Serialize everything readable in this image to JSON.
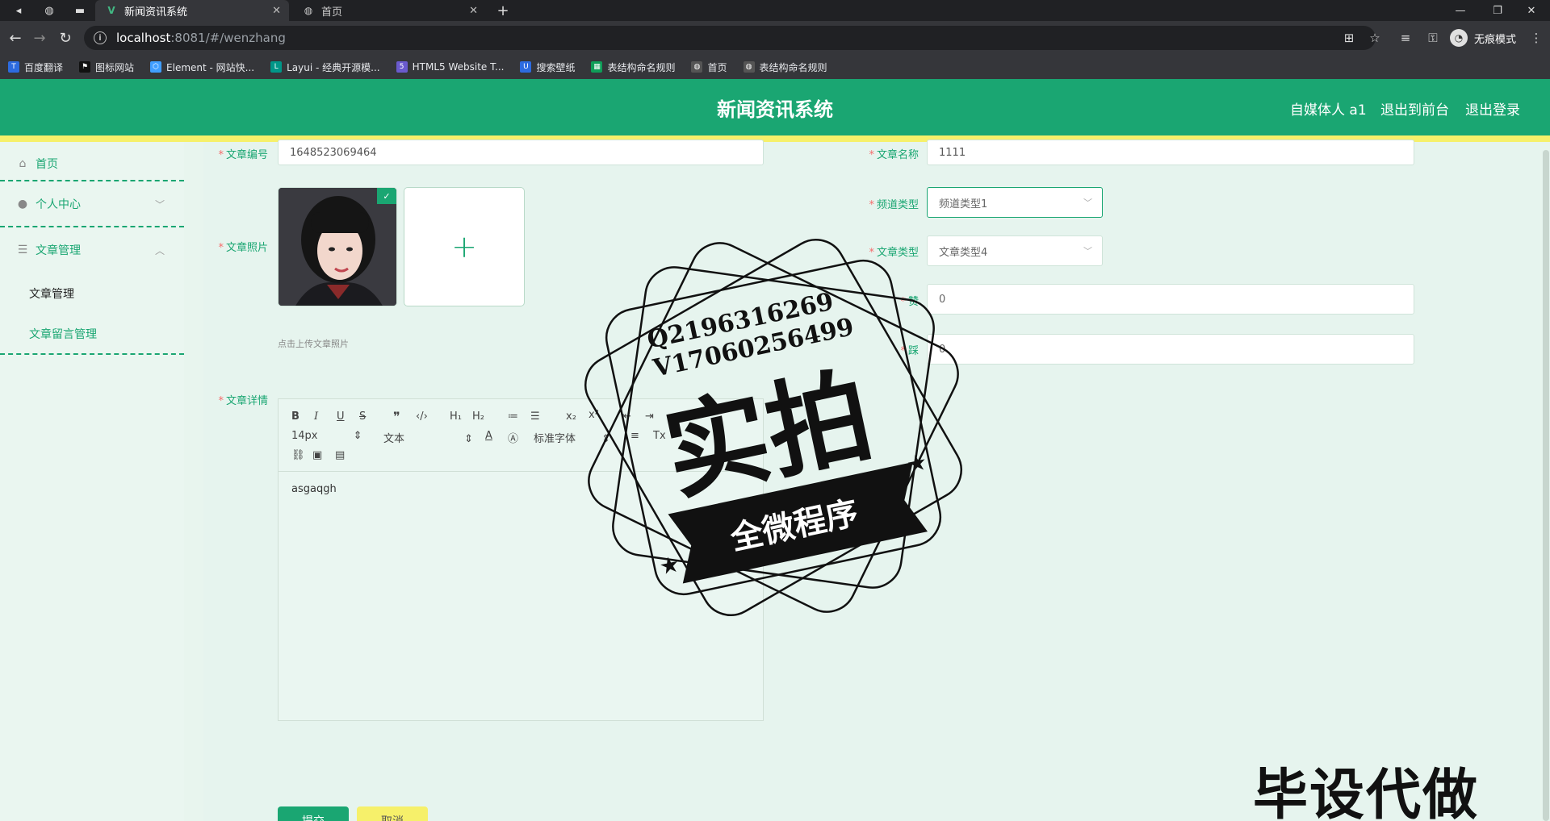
{
  "browser": {
    "tabs": [
      {
        "title": "新闻资讯系统",
        "active": true
      },
      {
        "title": "首页",
        "active": false
      }
    ],
    "url_host": "localhost",
    "url_path": ":8081/#/wenzhang",
    "incognito_label": "无痕模式",
    "bookmarks": [
      {
        "label": "百度翻译",
        "color": "#2d6bdf"
      },
      {
        "label": "图标网站",
        "color": "#333333"
      },
      {
        "label": "Element - 网站快...",
        "color": "#409eff"
      },
      {
        "label": "Layui - 经典开源模...",
        "color": "#009688"
      },
      {
        "label": "HTML5 Website T...",
        "color": "#6a5acd"
      },
      {
        "label": "搜索壁纸",
        "color": "#2d6bdf"
      },
      {
        "label": "表结构命名规则",
        "color": "#0f9d58"
      },
      {
        "label": "首页",
        "color": "#666666"
      },
      {
        "label": "表结构命名规则",
        "color": "#666666"
      }
    ]
  },
  "header": {
    "title": "新闻资讯系统",
    "user": "自媒体人 a1",
    "to_front": "退出到前台",
    "logout": "退出登录"
  },
  "sidebar": {
    "home": "首页",
    "personal": "个人中心",
    "article_mgmt": "文章管理",
    "sub_article": "文章管理",
    "sub_comment": "文章留言管理"
  },
  "form": {
    "article_no_label": "文章编号",
    "article_no": "1648523069464",
    "article_name_label": "文章名称",
    "article_name": "1111",
    "photo_label": "文章照片",
    "upload_tip": "点击上传文章照片",
    "channel_label": "频道类型",
    "channel_value": "频道类型1",
    "type_label": "文章类型",
    "type_value": "文章类型4",
    "field5_label": "赞",
    "field5_value": "0",
    "field6_label": "踩",
    "field6_value": "0",
    "detail_label": "文章详情",
    "editor": {
      "font_size": "14px",
      "paragraph": "文本",
      "font_family": "标准字体",
      "content": "asgaqgh"
    },
    "submit": "提交",
    "cancel": "取消"
  },
  "watermark": {
    "qq": "Q2196316269",
    "wx": "V17060256499",
    "big": "实拍",
    "ribbon": "全微程序",
    "corner": "毕设代做"
  },
  "colors": {
    "accent": "#1aa672",
    "highlight": "#f6f06a",
    "required": "#f56c6c"
  }
}
